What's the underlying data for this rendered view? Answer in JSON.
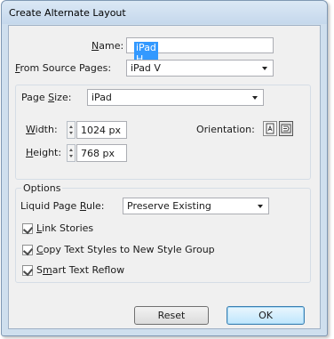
{
  "dialog": {
    "title": "Create Alternate Layout"
  },
  "name": {
    "label": "Name:",
    "value": "iPad H"
  },
  "source_pages": {
    "label": "From Source Pages:",
    "value": "iPad V"
  },
  "page_size": {
    "label": "Page Size:",
    "value": "iPad",
    "width_label": "Width:",
    "width_value": "1024 px",
    "height_label": "Height:",
    "height_value": "768 px",
    "orientation_label": "Orientation:",
    "orientation_selected": "landscape"
  },
  "options": {
    "heading": "Options",
    "liquid_rule_label": "Liquid Page Rule:",
    "liquid_rule_value": "Preserve Existing",
    "link_stories": {
      "label": "Link Stories",
      "checked": true
    },
    "copy_styles": {
      "label": "Copy Text Styles to New Style Group",
      "checked": true
    },
    "smart_reflow": {
      "label": "Smart Text Reflow",
      "checked": true
    }
  },
  "buttons": {
    "reset": "Reset",
    "ok": "OK"
  },
  "icons": {
    "portrait": "portrait-orientation-icon",
    "landscape": "landscape-orientation-icon"
  },
  "colors": {
    "selection": "#3399ff",
    "default_button_border": "#3c7fb1"
  }
}
